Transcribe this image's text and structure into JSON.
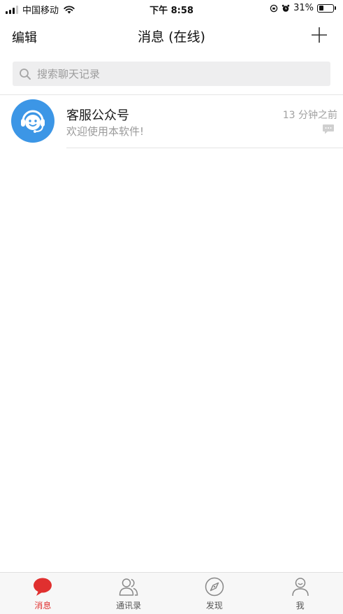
{
  "status_bar": {
    "carrier": "中国移动",
    "time": "下午 8:58",
    "battery": "31%",
    "battery_level": 0.31
  },
  "nav": {
    "edit_label": "编辑",
    "title": "消息 (在线)"
  },
  "search": {
    "placeholder": "搜索聊天记录"
  },
  "chats": [
    {
      "name": "客服公众号",
      "preview": "欢迎使用本软件!",
      "time": "13 分钟之前"
    }
  ],
  "tabs": [
    {
      "label": "消息",
      "icon": "chat-bubble-icon",
      "active": true
    },
    {
      "label": "通讯录",
      "icon": "contacts-icon",
      "active": false
    },
    {
      "label": "发现",
      "icon": "compass-icon",
      "active": false
    },
    {
      "label": "我",
      "icon": "profile-icon",
      "active": false
    }
  ],
  "colors": {
    "accent": "#e0302f",
    "avatar": "#3c96e6"
  }
}
